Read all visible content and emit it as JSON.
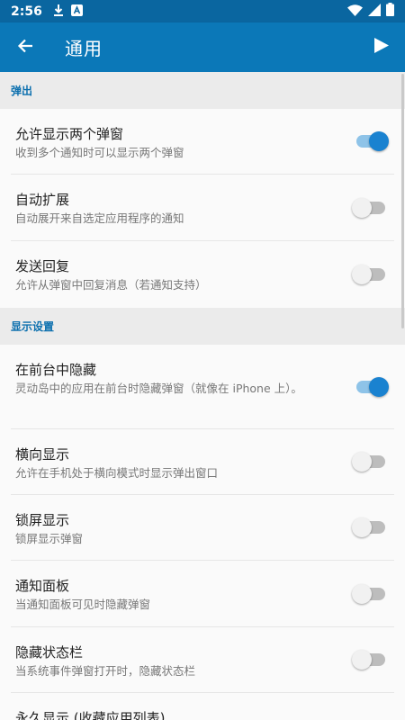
{
  "status_bar": {
    "time": "2:56"
  },
  "app_bar": {
    "title": "通用"
  },
  "colors": {
    "accent": "#0b78b8",
    "status_bar": "#0a66a0",
    "toggle_on": "#1a82d0"
  },
  "sections": [
    {
      "header": "弹出",
      "items": [
        {
          "title": "允许显示两个弹窗",
          "subtitle": "收到多个通知时可以显示两个弹窗",
          "on": true
        },
        {
          "title": "自动扩展",
          "subtitle": "自动展开来自选定应用程序的通知",
          "on": false
        },
        {
          "title": "发送回复",
          "subtitle": "允许从弹窗中回复消息（若通知支持）",
          "on": false
        }
      ]
    },
    {
      "header": "显示设置",
      "items": [
        {
          "title": "在前台中隐藏",
          "subtitle": "灵动岛中的应用在前台时隐藏弹窗（就像在 iPhone 上）。",
          "on": true
        },
        {
          "title": "横向显示",
          "subtitle": "允许在手机处于横向模式时显示弹出窗口",
          "on": false
        },
        {
          "title": "锁屏显示",
          "subtitle": "锁屏显示弹窗",
          "on": false
        },
        {
          "title": "通知面板",
          "subtitle": "当通知面板可见时隐藏弹窗",
          "on": false
        },
        {
          "title": "隐藏状态栏",
          "subtitle": "当系统事件弹窗打开时，隐藏状态栏",
          "on": false
        },
        {
          "title": "永久显示 (收藏应用列表)",
          "subtitle": "",
          "on": false
        }
      ]
    }
  ]
}
